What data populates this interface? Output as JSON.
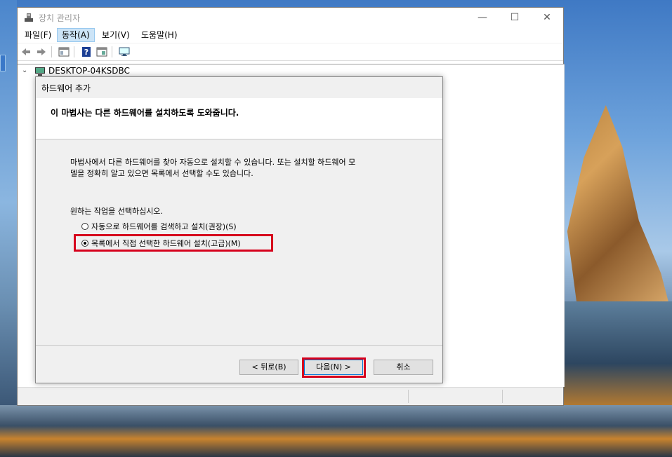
{
  "window": {
    "title": "장치 관리자",
    "controls": {
      "minimize": "—",
      "maximize": "☐",
      "close": "✕"
    }
  },
  "menu": {
    "items": [
      {
        "label": "파일(F)"
      },
      {
        "label": "동작(A)",
        "active": true
      },
      {
        "label": "보기(V)"
      },
      {
        "label": "도움말(H)"
      }
    ]
  },
  "toolbar": {
    "icons": [
      "back-arrow-icon",
      "forward-arrow-icon",
      "properties-icon",
      "help-icon",
      "view-icon",
      "monitor-icon"
    ]
  },
  "tree": {
    "root_label": "DESKTOP-04KSDBC",
    "expander": "⌄"
  },
  "dialog": {
    "title": "하드웨어 추가",
    "header": "이 마법사는 다른 하드웨어를 설치하도록 도와줍니다.",
    "description_line1": "마법사에서 다른 하드웨어를 찾아 자동으로 설치할 수 있습니다. 또는 설치할 하드웨어 모",
    "description_line2": "델을 정확히 알고 있으면 목록에서 선택할 수도 있습니다.",
    "prompt": "원하는 작업을 선택하십시오.",
    "options": [
      {
        "label": "자동으로 하드웨어를 검색하고 설치(권장)(S)",
        "checked": false
      },
      {
        "label": "목록에서 직접 선택한 하드웨어 설치(고급)(M)",
        "checked": true
      }
    ],
    "buttons": {
      "back": "< 뒤로(B)",
      "next": "다음(N) >",
      "cancel": "취소"
    }
  },
  "colors": {
    "highlight": "#d6001c",
    "menu_active": "#cce4f7",
    "dialog_bg": "#f0f0f0"
  }
}
